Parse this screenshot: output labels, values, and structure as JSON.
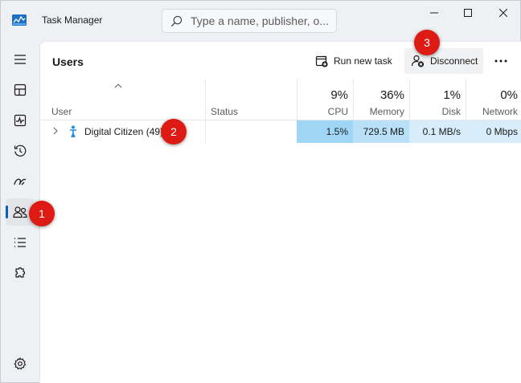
{
  "window": {
    "title": "Task Manager"
  },
  "search": {
    "placeholder": "Type a name, publisher, o..."
  },
  "page": {
    "title": "Users"
  },
  "toolbar": {
    "run_new_task": "Run new task",
    "disconnect": "Disconnect"
  },
  "nav": {
    "active": "users",
    "items": [
      "processes",
      "performance",
      "app-history",
      "startup-apps",
      "users",
      "details",
      "services",
      "settings"
    ]
  },
  "table": {
    "columns": {
      "user": "User",
      "status": "Status",
      "cpu": {
        "pct": "9%",
        "label": "CPU"
      },
      "memory": {
        "pct": "36%",
        "label": "Memory"
      },
      "disk": {
        "pct": "1%",
        "label": "Disk"
      },
      "network": {
        "pct": "0%",
        "label": "Network"
      }
    },
    "rows": [
      {
        "name": "Digital Citizen (49)",
        "status": "",
        "cpu": "1.5%",
        "memory": "729.5 MB",
        "disk": "0.1 MB/s",
        "network": "0 Mbps"
      }
    ]
  },
  "callouts": [
    "1",
    "2",
    "3"
  ],
  "colors": {
    "accent": "#0a5fb4",
    "cpu_heat": "#9fd6f5",
    "memory_heat": "#b9e0f7",
    "disk_heat": "#d7edfa",
    "callout": "#dd1b14"
  }
}
